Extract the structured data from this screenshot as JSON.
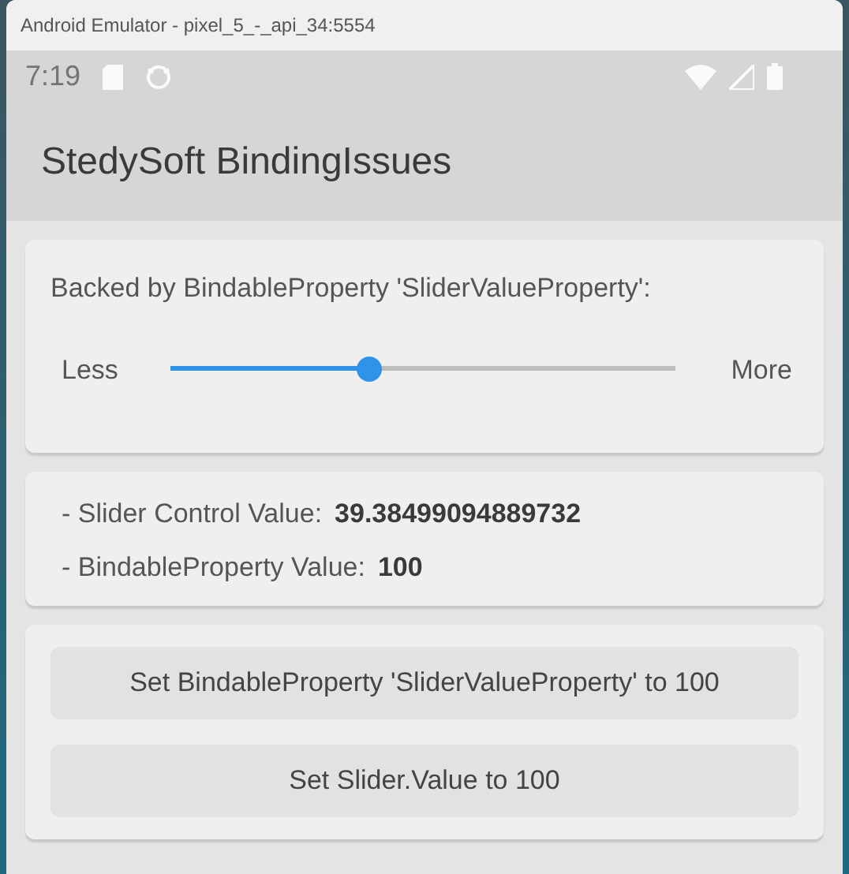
{
  "window": {
    "title": "Android Emulator - pixel_5_-_api_34:5554"
  },
  "status_bar": {
    "time": "7:19"
  },
  "app_bar": {
    "title": "StedySoft BindingIssues"
  },
  "slider_card": {
    "label": "Backed by BindableProperty 'SliderValueProperty':",
    "min_label": "Less",
    "max_label": "More",
    "level": 0.394
  },
  "values": [
    {
      "label": "- Slider Control Value:",
      "value": "39.38499094889732"
    },
    {
      "label": "- BindableProperty Value:",
      "value": "100"
    }
  ],
  "buttons": [
    "Set BindableProperty 'SliderValueProperty' to 100",
    "Set Slider.Value to 100"
  ]
}
